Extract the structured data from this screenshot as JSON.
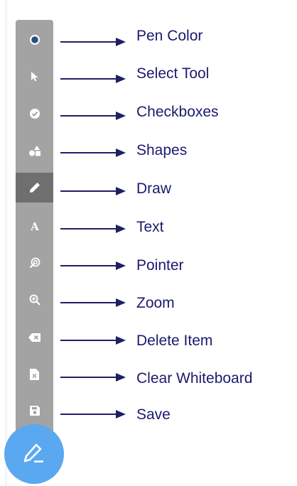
{
  "colors": {
    "toolbar_bg": "#a3a3a3",
    "active_tool_bg": "#6f6f6f",
    "icon_color": "#ffffff",
    "pen_color_dot": "#2b4f86",
    "arrow_color": "#1f1f66",
    "label_color": "#1a1a6e",
    "fab_bg": "#5aa8f0"
  },
  "toolbar": {
    "tools": [
      {
        "icon": "pen-color-icon",
        "label": "Pen Color"
      },
      {
        "icon": "cursor-arrow-icon",
        "label": "Select Tool"
      },
      {
        "icon": "check-circle-icon",
        "label": "Checkboxes"
      },
      {
        "icon": "shapes-icon",
        "label": "Shapes"
      },
      {
        "icon": "pencil-icon",
        "label": "Draw",
        "active": true
      },
      {
        "icon": "text-a-icon",
        "label": "Text"
      },
      {
        "icon": "pointer-icon",
        "label": "Pointer"
      },
      {
        "icon": "zoom-in-icon",
        "label": "Zoom"
      },
      {
        "icon": "backspace-icon",
        "label": "Delete Item"
      },
      {
        "icon": "clear-document-icon",
        "label": "Clear Whiteboard"
      },
      {
        "icon": "save-disk-icon",
        "label": "Save"
      }
    ]
  },
  "fab": {
    "icon": "edit-pencil-icon"
  }
}
